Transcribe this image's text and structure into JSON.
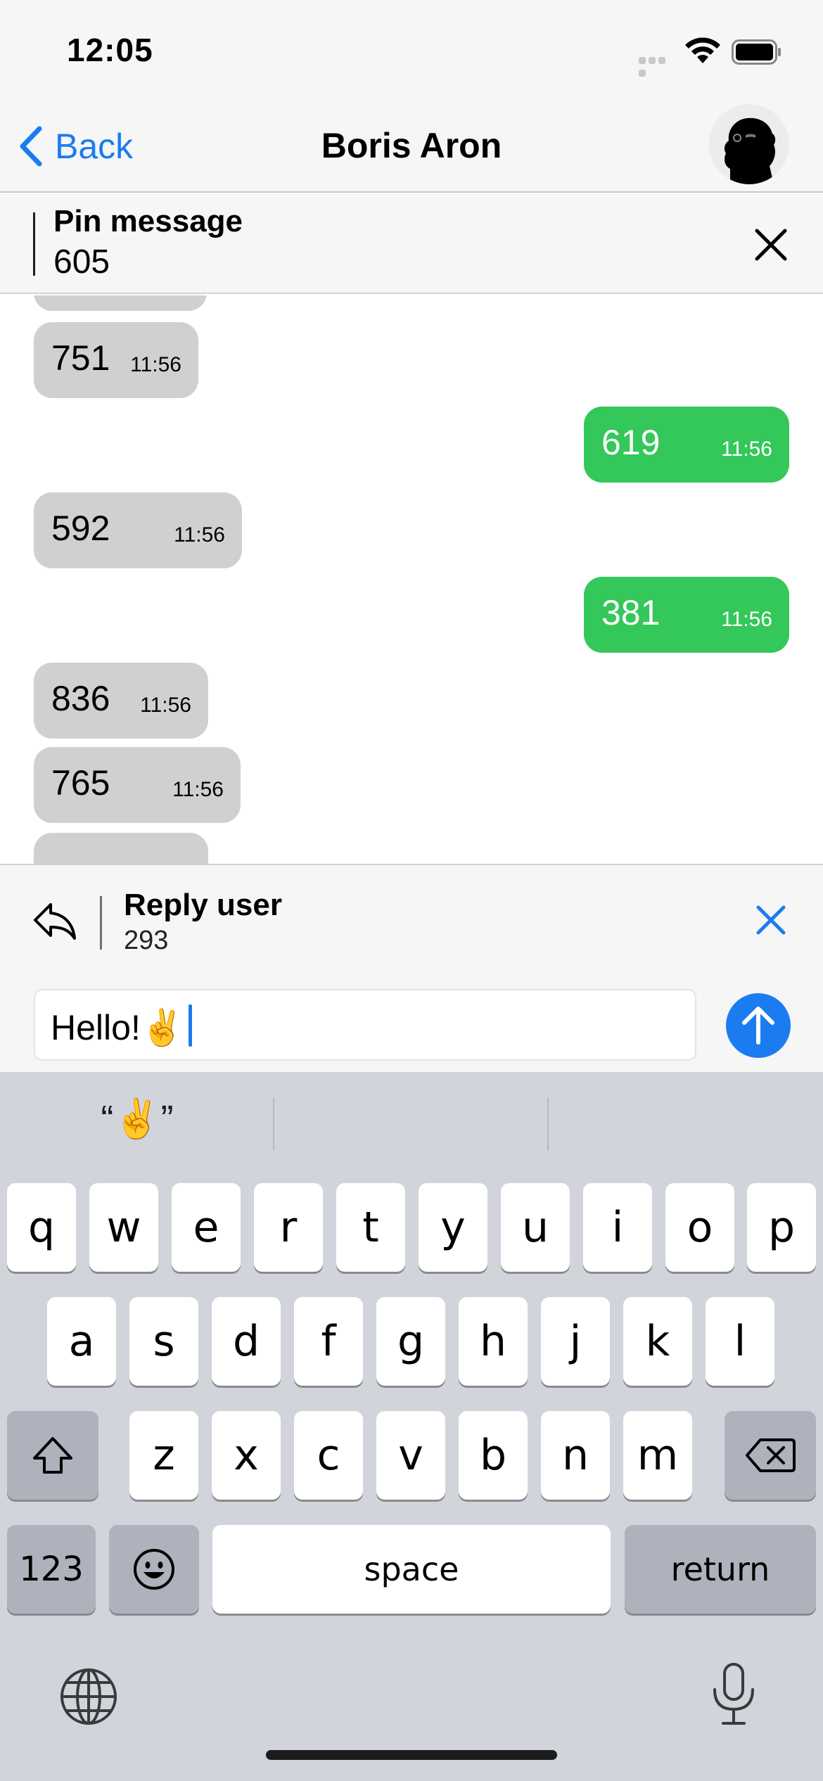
{
  "status_bar": {
    "time": "12:05"
  },
  "nav": {
    "back_label": "Back",
    "title": "Boris Aron"
  },
  "pin": {
    "title": "Pin message",
    "value": "605"
  },
  "messages": [
    {
      "text": "751",
      "time": "11:56",
      "direction": "incoming"
    },
    {
      "text": "619",
      "time": "11:56",
      "direction": "outgoing"
    },
    {
      "text": "592",
      "time": "11:56",
      "direction": "incoming"
    },
    {
      "text": "381",
      "time": "11:56",
      "direction": "outgoing"
    },
    {
      "text": "836",
      "time": "11:56",
      "direction": "incoming"
    },
    {
      "text": "765",
      "time": "11:56",
      "direction": "incoming"
    }
  ],
  "reply": {
    "title": "Reply user",
    "value": "293"
  },
  "input": {
    "value": "Hello!✌️"
  },
  "keyboard": {
    "suggestion": "“✌️”",
    "row1": [
      "q",
      "w",
      "e",
      "r",
      "t",
      "y",
      "u",
      "i",
      "o",
      "p"
    ],
    "row2": [
      "a",
      "s",
      "d",
      "f",
      "g",
      "h",
      "j",
      "k",
      "l"
    ],
    "row3": [
      "z",
      "x",
      "c",
      "v",
      "b",
      "n",
      "m"
    ],
    "numbers_label": "123",
    "space_label": "space",
    "return_label": "return"
  },
  "colors": {
    "accent": "#1a7cf0",
    "outgoing_bubble": "#34c759",
    "incoming_bubble": "#d0d0d0",
    "keyboard_bg": "#d1d4db"
  },
  "icons": {
    "back": "chevron-left-icon",
    "pin_close": "close-icon",
    "reply": "reply-arrow-icon",
    "reply_close": "close-icon",
    "send": "arrow-up-icon",
    "shift": "shift-icon",
    "backspace": "backspace-icon",
    "emoji": "emoji-icon",
    "globe": "globe-icon",
    "mic": "microphone-icon"
  }
}
